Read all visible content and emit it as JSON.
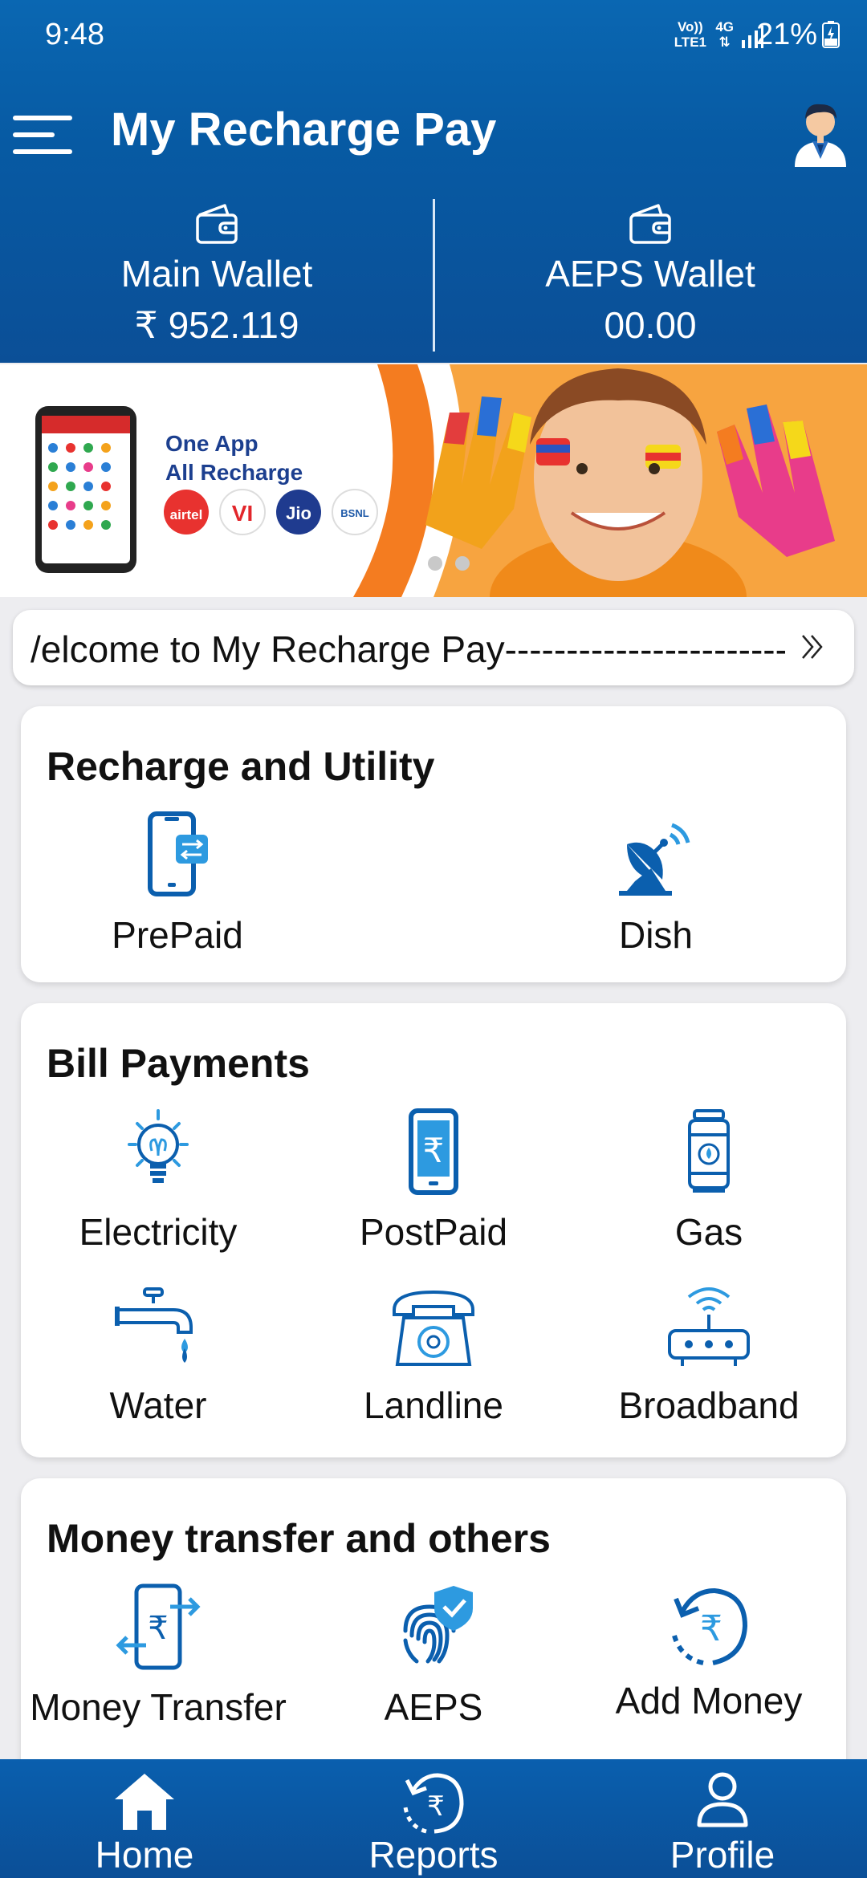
{
  "status_bar": {
    "time": "9:48",
    "network_top": "Vo))",
    "network_bottom": "LTE1",
    "network_type": "4G",
    "battery": "21%"
  },
  "header": {
    "title": "My Recharge Pay"
  },
  "wallets": [
    {
      "name": "Main Wallet",
      "amount": "₹ 952.119"
    },
    {
      "name": "AEPS Wallet",
      "amount": "00.00"
    }
  ],
  "banner": {
    "line1": "One App",
    "line2": "All Recharge",
    "brands": [
      "airtel",
      "VI",
      "Jio",
      "BSNL"
    ]
  },
  "marquee": {
    "text": "/elcome to My Recharge Pay-----------------------"
  },
  "recharge_section": {
    "title": "Recharge and Utility",
    "items": [
      {
        "label": "PrePaid"
      },
      {
        "label": "Dish"
      }
    ]
  },
  "bill_section": {
    "title": "Bill Payments",
    "items": [
      {
        "label": "Electricity"
      },
      {
        "label": "PostPaid"
      },
      {
        "label": "Gas"
      },
      {
        "label": "Water"
      },
      {
        "label": "Landline"
      },
      {
        "label": "Broadband"
      }
    ]
  },
  "money_section": {
    "title": "Money transfer and others",
    "items": [
      {
        "label": "Money Transfer"
      },
      {
        "label": "AEPS"
      },
      {
        "label": "Add Money"
      }
    ]
  },
  "bottom_nav": [
    {
      "label": "Home"
    },
    {
      "label": "Reports"
    },
    {
      "label": "Profile"
    }
  ],
  "colors": {
    "primary": "#0b5ca8",
    "icon_blue": "#0b5fae",
    "icon_light": "#2d9ae0",
    "background": "#ededf0"
  }
}
